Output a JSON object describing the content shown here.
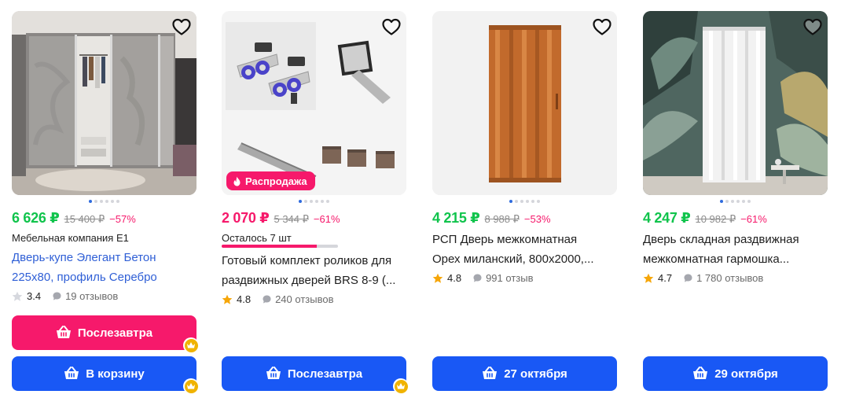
{
  "colors": {
    "price_green": "#10c44c",
    "accent_pink": "#f6196b",
    "button_blue": "#1958f5",
    "link_blue": "#2f5fd6"
  },
  "products": [
    {
      "price": "6 626 ₽",
      "old_price": "15 400 ₽",
      "discount": "−57%",
      "seller": "Мебельная компания Е1",
      "title_line1": "Дверь-купе Элегант Бетон",
      "title_line2": "225х80, профиль Серебро",
      "rating": "3.4",
      "reviews": "19 отзывов",
      "delivery_button": "Послезавтра",
      "cart_button": "В корзину",
      "image_icon": "wardrobe-image"
    },
    {
      "price": "2 070 ₽",
      "old_price": "5 344 ₽",
      "discount": "−61%",
      "badge": "Распродажа",
      "stock_text": "Осталось 7 шт",
      "stock_level": 0.82,
      "title_line1": "Готовый комплект роликов для",
      "title_line2": "раздвижных дверей BRS 8-9 (...",
      "rating": "4.8",
      "reviews": "240 отзывов",
      "delivery_button": "Послезавтра",
      "image_icon": "rollers-kit-image"
    },
    {
      "price": "4 215 ₽",
      "old_price": "8 988 ₽",
      "discount": "−53%",
      "title_line1": "РСП Дверь межкомнатная",
      "title_line2": "Орех миланский, 800х2000,...",
      "rating": "4.8",
      "reviews": "991 отзыв",
      "delivery_button": "27 октября",
      "image_icon": "folding-door-brown-image"
    },
    {
      "price": "4 247 ₽",
      "old_price": "10 982 ₽",
      "discount": "−61%",
      "title_line1": "Дверь складная раздвижная",
      "title_line2": "межкомнатная гармошка...",
      "rating": "4.7",
      "reviews": "1 780 отзывов",
      "delivery_button": "29 октября",
      "image_icon": "folding-door-white-image"
    }
  ]
}
